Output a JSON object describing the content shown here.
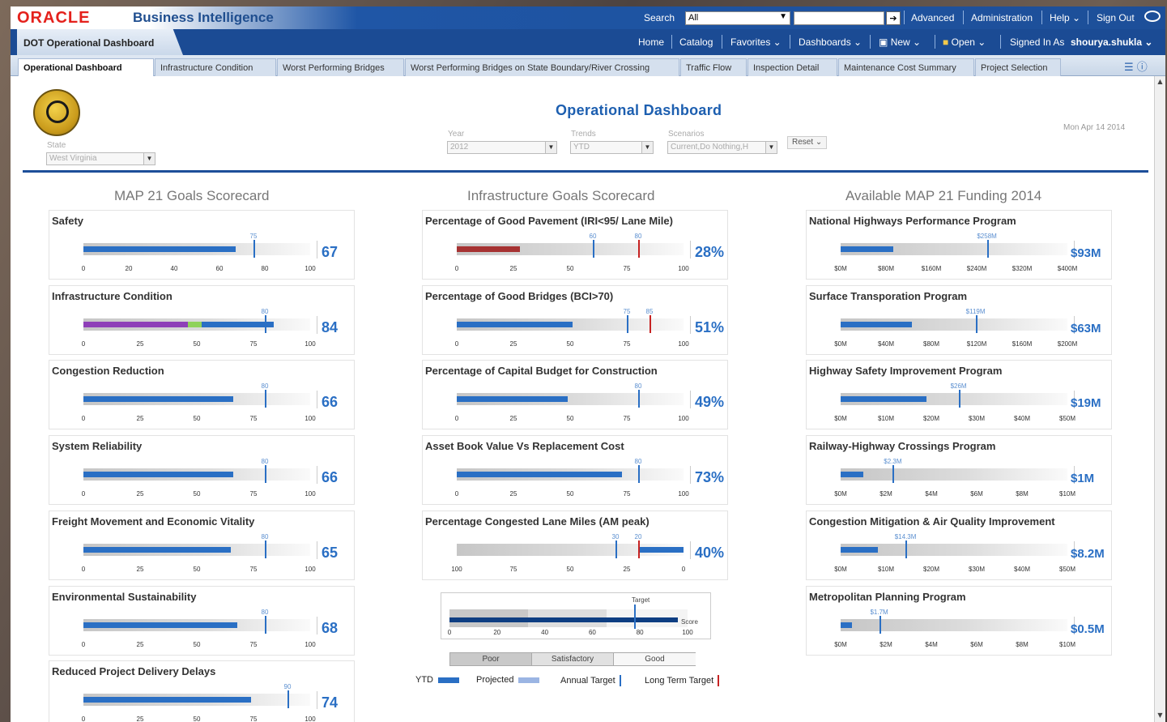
{
  "brand": {
    "oracle": "ORACLE",
    "product": "Business Intelligence"
  },
  "topbar": {
    "search_label": "Search",
    "search_scope": "All",
    "links": [
      "Advanced",
      "Administration",
      "Help ⌄",
      "Sign Out"
    ]
  },
  "navbar": {
    "dashboard_title": "DOT Operational Dashboard",
    "links": [
      "Home",
      "Catalog",
      "Favorites ⌄",
      "Dashboards ⌄",
      "New ⌄",
      "Open ⌄",
      "Signed In As"
    ],
    "user": "shourya.shukla ⌄"
  },
  "tabs": [
    "Operational Dashboard",
    "Infrastructure Condition",
    "Worst Performing Bridges",
    "Worst Performing Bridges on State Boundary/River Crossing",
    "Traffic Flow",
    "Inspection Detail",
    "Maintenance Cost Summary",
    "Project Selection"
  ],
  "filters": {
    "state": {
      "label": "State",
      "value": "West Virginia"
    },
    "year": {
      "label": "Year",
      "value": "2012"
    },
    "trends": {
      "label": "Trends",
      "value": "YTD"
    },
    "scenarios": {
      "label": "Scenarios",
      "value": "Current,Do Nothing,H"
    },
    "reset": "Reset ⌄"
  },
  "page_title": "Operational Dashboard",
  "date": "Mon Apr 14 2014",
  "columns": {
    "map21": {
      "title": "MAP 21 Goals Scorecard",
      "cards": [
        {
          "title": "Safety",
          "value": "67",
          "target": "75",
          "axis": [
            "0",
            "20",
            "40",
            "60",
            "80",
            "100"
          ],
          "ytd": 67,
          "target_pct": 75
        },
        {
          "title": "Infrastructure Condition",
          "value": "84",
          "target": "80",
          "axis": [
            "0",
            "25",
            "50",
            "75",
            "100"
          ],
          "ytd": 84,
          "target_pct": 80,
          "multi": true
        },
        {
          "title": "Congestion Reduction",
          "value": "66",
          "target": "80",
          "axis": [
            "0",
            "25",
            "50",
            "75",
            "100"
          ],
          "ytd": 66,
          "target_pct": 80
        },
        {
          "title": "System Reliability",
          "value": "66",
          "target": "80",
          "axis": [
            "0",
            "25",
            "50",
            "75",
            "100"
          ],
          "ytd": 66,
          "target_pct": 80
        },
        {
          "title": "Freight Movement and Economic Vitality",
          "value": "65",
          "target": "80",
          "axis": [
            "0",
            "25",
            "50",
            "75",
            "100"
          ],
          "ytd": 65,
          "target_pct": 80
        },
        {
          "title": "Environmental Sustainability",
          "value": "68",
          "target": "80",
          "axis": [
            "0",
            "25",
            "50",
            "75",
            "100"
          ],
          "ytd": 68,
          "target_pct": 80
        },
        {
          "title": "Reduced Project Delivery Delays",
          "value": "74",
          "target": "90",
          "axis": [
            "0",
            "25",
            "50",
            "75",
            "100"
          ],
          "ytd": 74,
          "target_pct": 90
        }
      ]
    },
    "infra": {
      "title": "Infrastructure Goals Scorecard",
      "cards": [
        {
          "title": "Percentage of Good Pavement (IRI<95/ Lane Mile)",
          "value": "28%",
          "targets": [
            "60",
            "80"
          ],
          "axis": [
            "0",
            "25",
            "50",
            "75",
            "100"
          ],
          "ytd": 28,
          "target_pcts": [
            60,
            80
          ],
          "red_bar": true
        },
        {
          "title": "Percentage of Good Bridges (BCI>70)",
          "value": "51%",
          "targets": [
            "75",
            "85"
          ],
          "axis": [
            "0",
            "25",
            "50",
            "75",
            "100"
          ],
          "ytd": 51,
          "target_pcts": [
            75,
            85
          ]
        },
        {
          "title": "Percentage of Capital Budget for Construction",
          "value": "49%",
          "targets": [
            "80"
          ],
          "axis": [
            "0",
            "25",
            "50",
            "75",
            "100"
          ],
          "ytd": 49,
          "target_pcts": [
            80
          ]
        },
        {
          "title": "Asset Book Value Vs Replacement Cost",
          "value": "73%",
          "targets": [
            "80"
          ],
          "axis": [
            "0",
            "25",
            "50",
            "75",
            "100"
          ],
          "ytd": 73,
          "target_pcts": [
            80
          ]
        },
        {
          "title": "Percentage Congested Lane Miles (AM peak)",
          "value": "40%",
          "targets": [
            "30",
            "20"
          ],
          "axis": [
            "100",
            "75",
            "50",
            "25",
            "0"
          ],
          "ytd": 40,
          "target_pcts": [
            70,
            80
          ],
          "reverse": true
        }
      ]
    },
    "funding": {
      "title": "Available MAP 21 Funding 2014",
      "cards": [
        {
          "title": "National Highways Performance Program",
          "value": "$93M",
          "target": "$258M",
          "axis": [
            "$0M",
            "$80M",
            "$160M",
            "$240M",
            "$320M",
            "$400M"
          ],
          "ytd": 23.25,
          "target_pct": 64.5
        },
        {
          "title": "Surface Transporation Program",
          "value": "$63M",
          "target": "$119M",
          "axis": [
            "$0M",
            "$40M",
            "$80M",
            "$120M",
            "$160M",
            "$200M"
          ],
          "ytd": 31.5,
          "target_pct": 59.5
        },
        {
          "title": "Highway Safety Improvement Program",
          "value": "$19M",
          "target": "$26M",
          "axis": [
            "$0M",
            "$10M",
            "$20M",
            "$30M",
            "$40M",
            "$50M"
          ],
          "ytd": 38,
          "target_pct": 52
        },
        {
          "title": "Railway-Highway Crossings Program",
          "value": "$1M",
          "target": "$2.3M",
          "axis": [
            "$0M",
            "$2M",
            "$4M",
            "$6M",
            "$8M",
            "$10M"
          ],
          "ytd": 10,
          "target_pct": 23
        },
        {
          "title": "Congestion Mitigation & Air Quality Improvement",
          "value": "$8.2M",
          "target": "$14.3M",
          "axis": [
            "$0M",
            "$10M",
            "$20M",
            "$30M",
            "$40M",
            "$50M"
          ],
          "ytd": 16.4,
          "target_pct": 28.6
        },
        {
          "title": "Metropolitan Planning Program",
          "value": "$0.5M",
          "target": "$1.7M",
          "axis": [
            "$0M",
            "$2M",
            "$4M",
            "$6M",
            "$8M",
            "$10M"
          ],
          "ytd": 5,
          "target_pct": 17
        }
      ]
    }
  },
  "legend_gauge": {
    "target_label": "Target",
    "score_label": "Score",
    "axis": [
      "0",
      "20",
      "40",
      "60",
      "80",
      "100"
    ],
    "bands": [
      "Poor",
      "Satisfactory",
      "Good"
    ]
  },
  "legend": {
    "ytd": "YTD",
    "projected": "Projected",
    "annual_target": "Annual Target",
    "long_term_target": "Long Term Target"
  },
  "colors": {
    "accent": "#2a6fc4",
    "red_target": "#c62323",
    "brand_red": "#e4211c",
    "nav": "#1b4b94"
  }
}
